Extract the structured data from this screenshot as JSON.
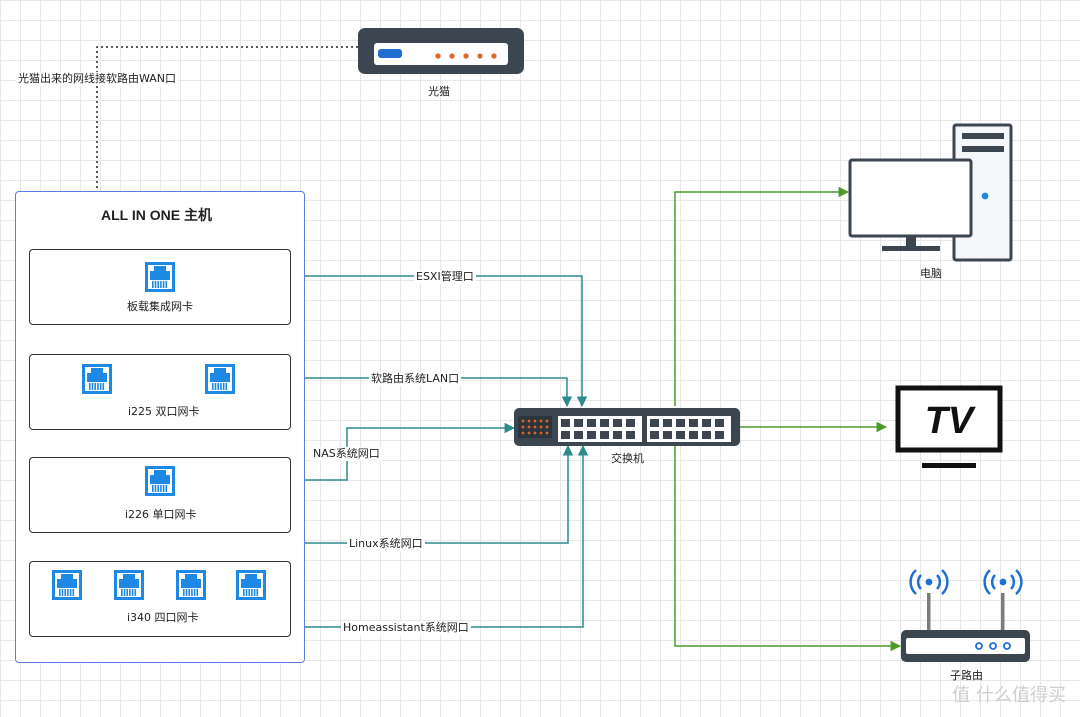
{
  "nodes": {
    "modem": "光猫",
    "host": "ALL IN ONE 主机",
    "nic_onboard": "板载集成网卡",
    "nic_i225": "i225 双口网卡",
    "nic_i226": "i226 单口网卡",
    "nic_i340": "i340 四口网卡",
    "switch": "交换机",
    "pc": "电脑",
    "tv_text": "TV",
    "sub_router": "子路由"
  },
  "edges": {
    "wan": "光猫出来的网线接软路由WAN口",
    "esxi": "ESXI管理口",
    "lan": "软路由系统LAN口",
    "nas": "NAS系统网口",
    "linux": "Linux系统网口",
    "ha": "Homeassistant系统网口"
  },
  "watermark": "值 什么值得买",
  "colors": {
    "teal": "#2e8b8b",
    "green": "#4c9a2a",
    "port_blue": "#1e88e5",
    "device_dark": "#3c4650",
    "host_border": "#5b7ee6"
  }
}
